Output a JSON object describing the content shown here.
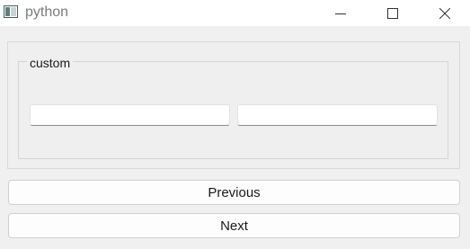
{
  "window": {
    "title": "python",
    "icons": {
      "app": "python-app-icon",
      "minimize": "minimize-icon",
      "maximize": "maximize-icon",
      "close": "close-icon"
    }
  },
  "group": {
    "title": "custom",
    "inputs": [
      {
        "value": "",
        "placeholder": ""
      },
      {
        "value": "",
        "placeholder": ""
      }
    ]
  },
  "buttons": {
    "previous_label": "Previous",
    "next_label": "Next"
  }
}
